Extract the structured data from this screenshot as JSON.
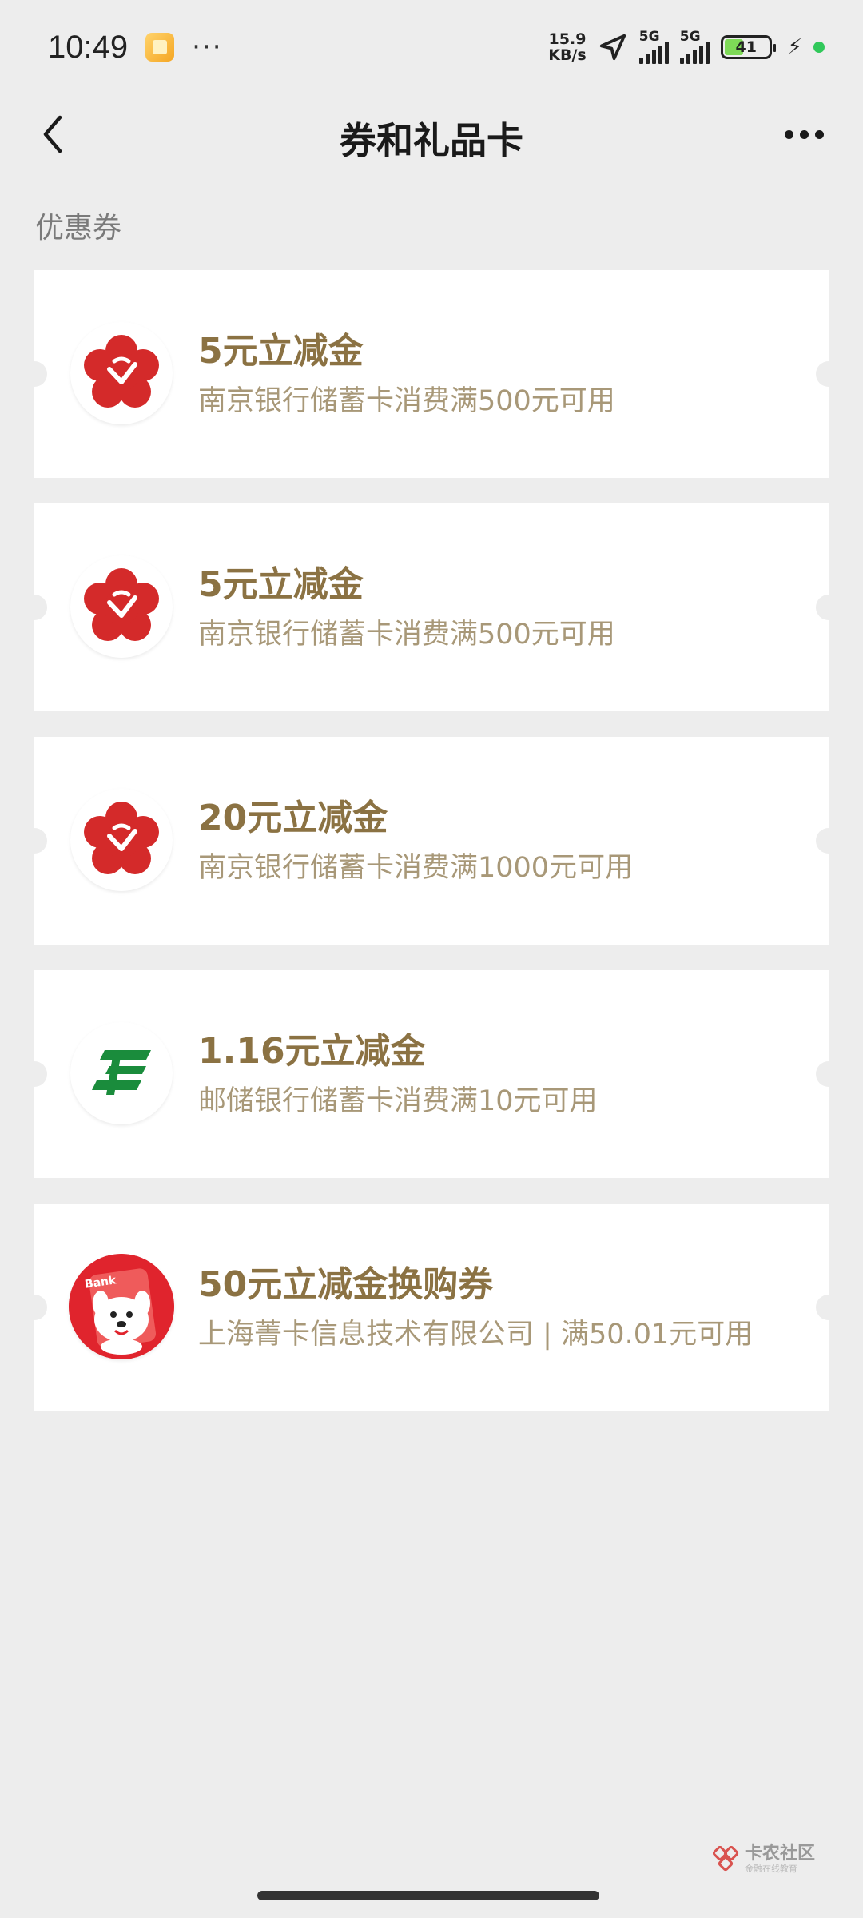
{
  "status_bar": {
    "time": "10:49",
    "more": "···",
    "net_speed_value": "15.9",
    "net_speed_unit": "KB/s",
    "signal1_label": "5G",
    "signal2_label": "5G",
    "battery_level": "41"
  },
  "nav": {
    "title": "券和礼品卡"
  },
  "section": {
    "label": "优惠券"
  },
  "coupons": [
    {
      "title": "5元立减金",
      "desc": "南京银行储蓄卡消费满500元可用",
      "logo": "nanjing-bank-logo"
    },
    {
      "title": "5元立减金",
      "desc": "南京银行储蓄卡消费满500元可用",
      "logo": "nanjing-bank-logo"
    },
    {
      "title": "20元立减金",
      "desc": "南京银行储蓄卡消费满1000元可用",
      "logo": "nanjing-bank-logo"
    },
    {
      "title": "1.16元立减金",
      "desc": "邮储银行储蓄卡消费满10元可用",
      "logo": "postal-savings-bank-logo"
    },
    {
      "title": "50元立减金换购券",
      "desc": "上海菁卡信息技术有限公司 | 满50.01元可用",
      "logo": "jd-dog-bank-logo",
      "logo_text": "Bank"
    }
  ],
  "watermark": {
    "main": "卡农社区",
    "sub": "金融在线教育"
  },
  "colors": {
    "background": "#ededed",
    "coupon_title": "#8b7243",
    "coupon_desc": "#a89878",
    "nanjing_red": "#d42a2a",
    "postal_green": "#1a8c3c",
    "jd_red": "#e0242d"
  }
}
